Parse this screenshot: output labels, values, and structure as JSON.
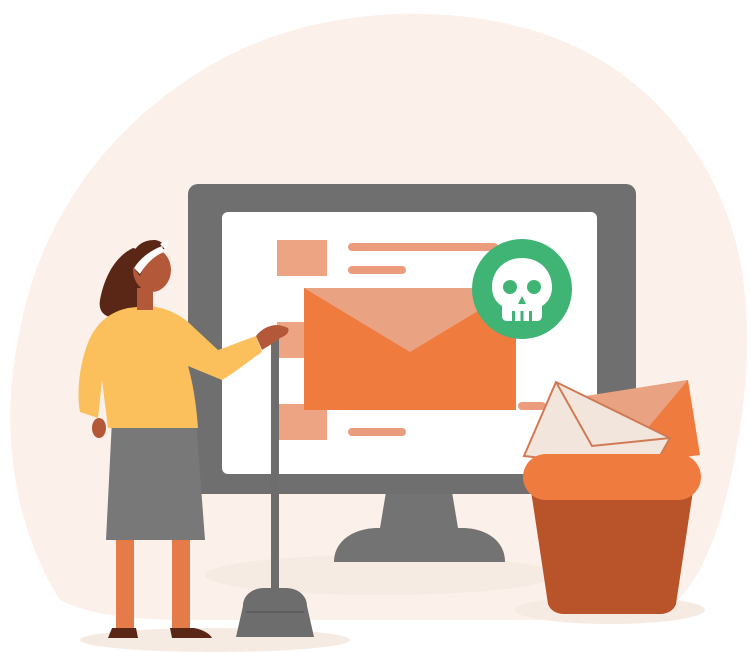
{
  "illustration": {
    "subject": "woman-sweeping-malicious-email-into-trash",
    "icons": [
      "skull-icon",
      "envelope-icon",
      "trash-bin-icon",
      "broom-icon",
      "monitor-icon"
    ]
  },
  "colors": {
    "background_blob": "#fbf0ea",
    "shadow": "#f6ebe3",
    "monitor_frame": "#6f6f6f",
    "monitor_stand": "#737373",
    "screen": "#ffffff",
    "content_block": "#eda483",
    "content_line": "#eb9c7d",
    "envelope_body": "#f07b3f",
    "envelope_flap": "#e9a282",
    "skull_badge": "#3fb474",
    "skull": "#ffffff",
    "bin_rim": "#f07b3f",
    "bin_body": "#b9532a",
    "paper_envelope": "#f1e5dc",
    "paper_outline": "#d07a55",
    "skin": "#b3593a",
    "hair": "#5a2716",
    "headband": "#ffffff",
    "sweater": "#fbbf5b",
    "skirt": "#787878",
    "legs": "#e57b49",
    "shoes": "#5a2716",
    "broom": "#6d6d6d"
  }
}
